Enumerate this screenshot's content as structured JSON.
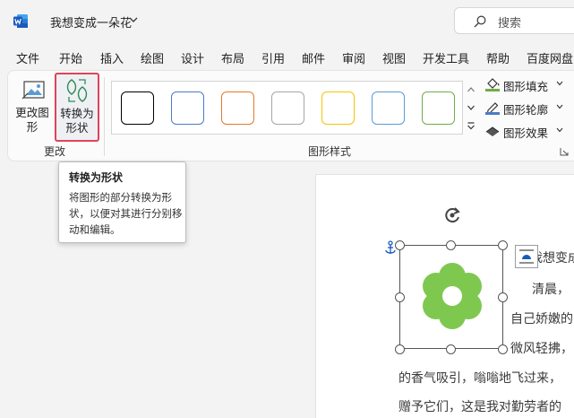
{
  "titlebar": {
    "doc_title": "我想变成一朵花",
    "search_label": "搜索"
  },
  "menu": {
    "items": [
      "文件",
      "开始",
      "插入",
      "绘图",
      "设计",
      "布局",
      "引用",
      "邮件",
      "审阅",
      "视图",
      "开发工具",
      "帮助",
      "百度网盘"
    ]
  },
  "ribbon": {
    "change_shape_label": "更改图形",
    "convert_label": "转换为形状",
    "group_change": "更改",
    "group_styles": "图形样式",
    "shape_fill": "图形填充",
    "shape_outline": "图形轮廓",
    "shape_effects": "图形效果",
    "style_colors": [
      "#000000",
      "#4a7cc4",
      "#e07b2b",
      "#a6a6a6",
      "#f5c400",
      "#5b9bd5",
      "#70ad47"
    ]
  },
  "tooltip": {
    "title": "转换为形状",
    "body": "将图形的部分转换为形状，以便对其进行分别移动和编辑。"
  },
  "document": {
    "lines": [
      "我想变成",
      "清晨，",
      "自己娇嫩的",
      "微风轻拂，",
      "的香气吸引，嗡嗡地飞过来，",
      "赠予它们，这是我对勤劳者的"
    ]
  },
  "colors": {
    "flower_fill": "#7ec850",
    "highlight_border": "#e0435a",
    "word_blue": "#185abd"
  }
}
